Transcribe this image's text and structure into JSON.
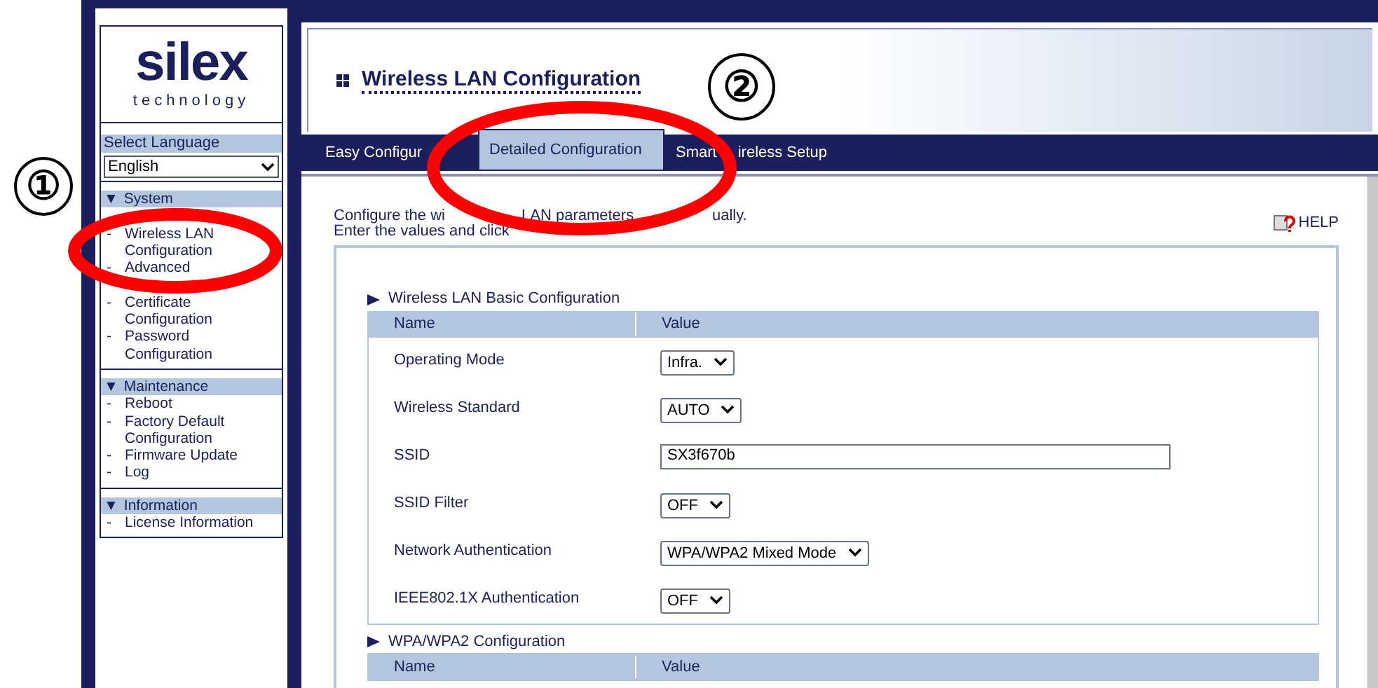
{
  "callouts": [
    "①",
    "②"
  ],
  "sidebar": {
    "logo": {
      "name": "silex",
      "tagline": "technology"
    },
    "language_label": "Select Language",
    "language": "English",
    "sections": [
      {
        "marker": "▼",
        "heading": "System",
        "items": [
          {
            "bullet": "-",
            "text": "Wireless LAN Configuration"
          },
          {
            "bullet": "-",
            "text": "Advanced"
          },
          {
            "bullet": "-",
            "text": "Certificate Configuration"
          },
          {
            "bullet": "-",
            "text": "Password Configuration"
          }
        ]
      },
      {
        "marker": "▼",
        "heading": "Maintenance",
        "items": [
          {
            "bullet": "-",
            "text": "Reboot"
          },
          {
            "bullet": "-",
            "text": "Factory Default Configuration"
          },
          {
            "bullet": "-",
            "text": "Firmware Update"
          },
          {
            "bullet": "-",
            "text": "Log"
          }
        ]
      },
      {
        "marker": "▼",
        "heading": "Information",
        "items": [
          {
            "bullet": "-",
            "text": "License Information"
          }
        ]
      }
    ]
  },
  "page_title": "Wireless LAN Configuration",
  "tabs": [
    {
      "label_parts": [
        "Easy Configur"
      ],
      "selected": false
    },
    {
      "label_parts": [
        "Detailed Configuration"
      ],
      "selected": true
    },
    {
      "label_parts": [
        "Smart",
        "ireless Setup"
      ],
      "selected": false
    }
  ],
  "intro": [
    [
      "Configure the wi",
      "LAN parameters",
      "ually."
    ],
    [
      "Enter the values and click"
    ]
  ],
  "help": "HELP",
  "sections": [
    {
      "title": "Wireless LAN Basic Configuration",
      "columns": [
        "Name",
        "Value"
      ],
      "rows": [
        {
          "name": "Operating Mode",
          "kind": "select",
          "value": "Infra."
        },
        {
          "name": "Wireless Standard",
          "kind": "select",
          "value": "AUTO"
        },
        {
          "name": "SSID",
          "kind": "text",
          "value": "SX3f670b"
        },
        {
          "name": "SSID Filter",
          "kind": "select",
          "value": "OFF"
        },
        {
          "name": "Network Authentication",
          "kind": "select",
          "value": "WPA/WPA2 Mixed Mode"
        },
        {
          "name": "IEEE802.1X Authentication",
          "kind": "select",
          "value": "OFF"
        }
      ]
    },
    {
      "title": "WPA/WPA2 Configuration",
      "columns": [
        "Name",
        "Value"
      ]
    }
  ]
}
